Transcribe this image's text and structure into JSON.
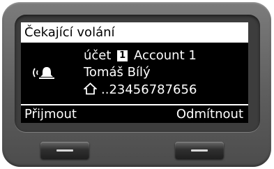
{
  "screen": {
    "title": "Čekající volání",
    "account_prefix": "účet",
    "account_number": "1",
    "account_name": "Account 1",
    "caller_name": "Tomáš Bílý",
    "caller_number": "..23456787656",
    "icons": [
      "ringing-bell-icon",
      "home-icon"
    ]
  },
  "softkeys": {
    "left": "Přijmout",
    "right": "Odmítnout"
  }
}
